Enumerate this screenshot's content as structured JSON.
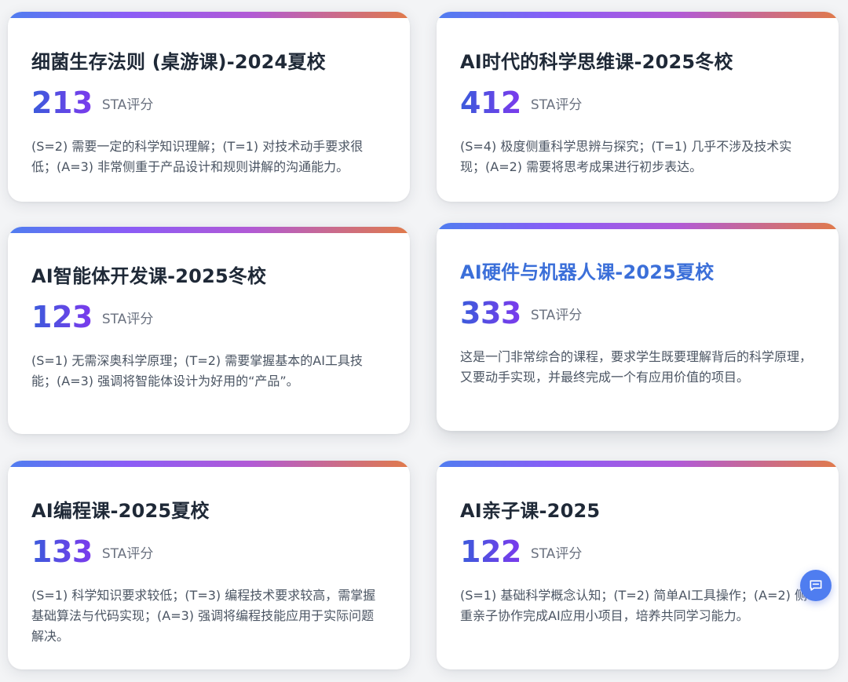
{
  "cards": [
    {
      "title": "细菌生存法则 (桌游课)-2024夏校",
      "score": "213",
      "score_label": "STA评分",
      "description": "(S=2) 需要一定的科学知识理解；(T=1) 对技术动手要求很低；(A=3) 非常侧重于产品设计和规则讲解的沟通能力。"
    },
    {
      "title": "AI时代的科学思维课-2025冬校",
      "score": "412",
      "score_label": "STA评分",
      "description": "(S=4) 极度侧重科学思辨与探究；(T=1) 几乎不涉及技术实现；(A=2) 需要将思考成果进行初步表达。"
    },
    {
      "title": "AI智能体开发课-2025冬校",
      "score": "123",
      "score_label": "STA评分",
      "description": "(S=1) 无需深奥科学原理；(T=2) 需要掌握基本的AI工具技能；(A=3) 强调将智能体设计为好用的“产品”。"
    },
    {
      "title": "AI硬件与机器人课-2025夏校",
      "score": "333",
      "score_label": "STA评分",
      "description": "这是一门非常综合的课程，要求学生既要理解背后的科学原理，又要动手实现，并最终完成一个有应用价值的项目。"
    },
    {
      "title": "AI编程课-2025夏校",
      "score": "133",
      "score_label": "STA评分",
      "description": "(S=1) 科学知识要求较低；(T=3) 编程技术要求较高，需掌握基础算法与代码实现；(A=3) 强调将编程技能应用于实际问题解决。"
    },
    {
      "title": "AI亲子课-2025",
      "score": "122",
      "score_label": "STA评分",
      "description": "(S=1) 基础科学概念认知；(T=2) 简单AI工具操作；(A=2) 侧重亲子协作完成AI应用小项目，培养共同学习能力。"
    }
  ],
  "chat_button": {
    "icon": "chat-icon",
    "color": "#4f7df0"
  },
  "colors": {
    "accent_gradient_start": "#4f7df0",
    "accent_gradient_mid": "#8b5cf6",
    "accent_gradient_end": "#e07a4a",
    "highlight_title": "#3b6fd9"
  }
}
